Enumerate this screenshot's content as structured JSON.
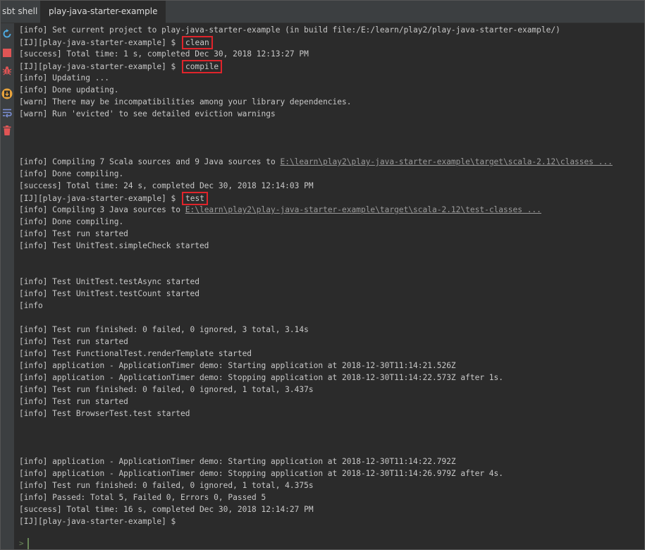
{
  "tabs": [
    "sbt shell",
    "play-java-starter-example"
  ],
  "toolbar": {
    "icons": [
      "refresh-icon",
      "stop-icon",
      "bug-icon",
      "download-icon",
      "wrap-icon",
      "trash-icon"
    ]
  },
  "console": {
    "lines": [
      {
        "text": "[info] Set current project to play-java-starter-example (in build file:/E:/learn/play2/play-java-starter-example/)"
      },
      {
        "text": "[IJ][play-java-starter-example] $ ",
        "cmd": "clean"
      },
      {
        "text": "[success] Total time: 1 s, completed Dec 30, 2018 12:13:27 PM"
      },
      {
        "text": "[IJ][play-java-starter-example] $ ",
        "cmd": "compile"
      },
      {
        "text": "[info] Updating ..."
      },
      {
        "text": "[info] Done updating."
      },
      {
        "text": "[warn] There may be incompatibilities among your library dependencies."
      },
      {
        "text": "[warn] Run 'evicted' to see detailed eviction warnings"
      },
      {
        "text": ""
      },
      {
        "text": ""
      },
      {
        "text": ""
      },
      {
        "text": "[info] Compiling 7 Scala sources and 9 Java sources to ",
        "link": "E:\\learn\\play2\\play-java-starter-example\\target\\scala-2.12\\classes ..."
      },
      {
        "text": "[info] Done compiling."
      },
      {
        "text": "[success] Total time: 24 s, completed Dec 30, 2018 12:14:03 PM"
      },
      {
        "text": "[IJ][play-java-starter-example] $ ",
        "cmd": "test"
      },
      {
        "text": "[info] Compiling 3 Java sources to ",
        "link": "E:\\learn\\play2\\play-java-starter-example\\target\\scala-2.12\\test-classes ..."
      },
      {
        "text": "[info] Done compiling."
      },
      {
        "text": "[info] Test run started"
      },
      {
        "text": "[info] Test UnitTest.simpleCheck started"
      },
      {
        "text": ""
      },
      {
        "text": ""
      },
      {
        "text": "[info] Test UnitTest.testAsync started"
      },
      {
        "text": "[info] Test UnitTest.testCount started"
      },
      {
        "text": "[info"
      },
      {
        "text": ""
      },
      {
        "text": "[info] Test run finished: 0 failed, 0 ignored, 3 total, 3.14s"
      },
      {
        "text": "[info] Test run started"
      },
      {
        "text": "[info] Test FunctionalTest.renderTemplate started"
      },
      {
        "text": "[info] application - ApplicationTimer demo: Starting application at 2018-12-30T11:14:21.526Z"
      },
      {
        "text": "[info] application - ApplicationTimer demo: Stopping application at 2018-12-30T11:14:22.573Z after 1s."
      },
      {
        "text": "[info] Test run finished: 0 failed, 0 ignored, 1 total, 3.437s"
      },
      {
        "text": "[info] Test run started"
      },
      {
        "text": "[info] Test BrowserTest.test started"
      },
      {
        "text": ""
      },
      {
        "text": ""
      },
      {
        "text": ""
      },
      {
        "text": "[info] application - ApplicationTimer demo: Starting application at 2018-12-30T11:14:22.792Z"
      },
      {
        "text": "[info] application - ApplicationTimer demo: Stopping application at 2018-12-30T11:14:26.979Z after 4s."
      },
      {
        "text": "[info] Test run finished: 0 failed, 0 ignored, 1 total, 4.375s"
      },
      {
        "text": "[info] Passed: Total 5, Failed 0, Errors 0, Passed 5"
      },
      {
        "text": "[success] Total time: 16 s, completed Dec 30, 2018 12:14:27 PM"
      },
      {
        "text": "[IJ][play-java-starter-example] $"
      }
    ]
  },
  "colors": {
    "background": "#2b2b2b",
    "tabbar": "#3c3f41",
    "text": "#c8c8c8",
    "highlight_box": "#e0242b",
    "refresh": "#4eade5",
    "stop": "#e05555",
    "bug": "#e05555",
    "download": "#e8a33c",
    "wrap": "#7b8fd6",
    "trash": "#e05555"
  }
}
